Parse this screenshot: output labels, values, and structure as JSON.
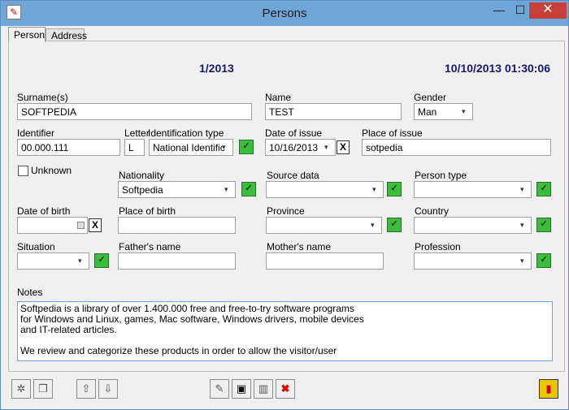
{
  "window": {
    "title": "Persons"
  },
  "titlebar": {
    "minimize_icon": "—",
    "maximize_icon": "☐",
    "close_icon": "✕",
    "app_icon": "✎"
  },
  "tabs": [
    {
      "label": "Person",
      "active": true
    },
    {
      "label": "Address",
      "active": false
    }
  ],
  "header": {
    "number": "1/2013",
    "datetime": "10/10/2013 01:30:06"
  },
  "surname": {
    "label": "Surname(s)",
    "value": "SOFTPEDIA"
  },
  "name": {
    "label": "Name",
    "value": "TEST"
  },
  "gender": {
    "label": "Gender",
    "value": "Man"
  },
  "identifier": {
    "label": "Identifier",
    "value": "00.000.111"
  },
  "letter": {
    "label": "Letter",
    "value": "L"
  },
  "id_type": {
    "label": "Identification type",
    "value": "National Identific"
  },
  "date_issue": {
    "label": "Date of issue",
    "value": "10/16/2013"
  },
  "place_issue": {
    "label": "Place of issue",
    "value": "sotpedia"
  },
  "unknown": {
    "label": "Unknown"
  },
  "nationality": {
    "label": "Nationality",
    "value": "Softpedia"
  },
  "source_data": {
    "label": "Source data",
    "value": ""
  },
  "person_type": {
    "label": "Person type",
    "value": ""
  },
  "date_birth": {
    "label": "Date of birth",
    "value": ""
  },
  "place_birth": {
    "label": "Place of birth",
    "value": ""
  },
  "province": {
    "label": "Province",
    "value": ""
  },
  "country": {
    "label": "Country",
    "value": ""
  },
  "situation": {
    "label": "Situation",
    "value": ""
  },
  "father": {
    "label": "Father's name",
    "value": ""
  },
  "mother": {
    "label": "Mother's name",
    "value": ""
  },
  "profession": {
    "label": "Profession",
    "value": ""
  },
  "notes": {
    "label": "Notes",
    "value": "Softpedia is a library of over 1.400.000 free and free-to-try software programs\nfor Windows and Linux, games, Mac software, Windows drivers, mobile devices\nand IT-related articles.\n\nWe review and categorize these products in order to allow the visitor/user"
  },
  "icons": {
    "dropdown": "▾",
    "check": "✓",
    "clear": "X",
    "up": "⇧",
    "down": "⇩",
    "delete": "✖"
  }
}
